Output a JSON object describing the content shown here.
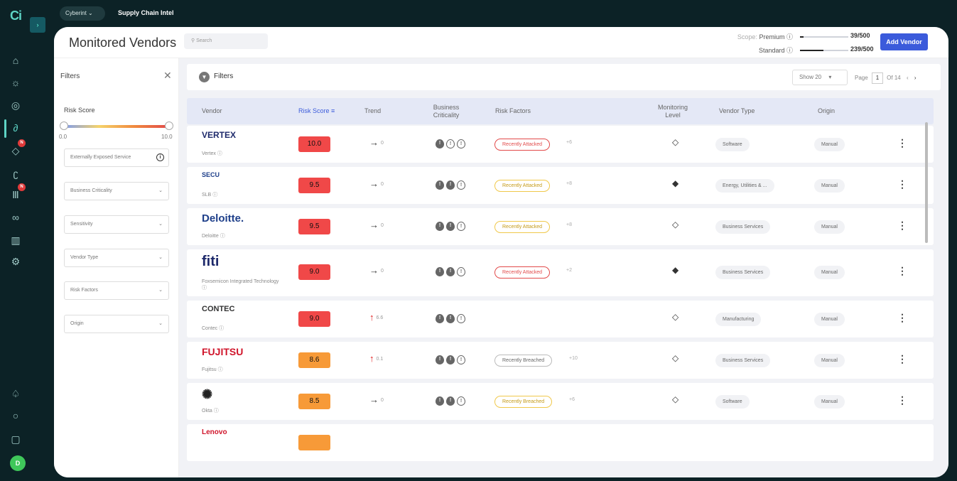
{
  "app": {
    "logo_text": "Ci",
    "expand_icon": "chevron-right-icon",
    "org_label": "Cyberint",
    "product_label": "Supply Chain Intel",
    "avatar_initial": "D",
    "notif_label": "N"
  },
  "rail_icons": [
    "home-icon",
    "alert-bulb-icon",
    "target-icon",
    "link-icon",
    "shield-icon",
    "fingerprint-icon",
    "library-icon",
    "modules-icon",
    "building-icon",
    "settings-icon",
    "notification-icon",
    "search-icon",
    "info-icon"
  ],
  "page": {
    "title": "Monitored Vendors",
    "search_placeholder": "Search"
  },
  "scope": {
    "label": "Scope:",
    "premium_label": "Premium",
    "premium_count": "39/500",
    "premium_fill": 0.078,
    "standard_label": "Standard",
    "standard_count": "239/500",
    "standard_fill": 0.478
  },
  "add_vendor_label": "Add Vendor",
  "filters_panel": {
    "title": "Filters",
    "risk_score_label": "Risk Score",
    "slider_min": "0.0",
    "slider_max": "10.0",
    "externally_exposed_label": "Externally Exposed Service",
    "selects": [
      "Business Criticality",
      "Sensitivity",
      "Vendor Type",
      "Risk Factors",
      "Origin"
    ]
  },
  "toolbar": {
    "filters_label": "Filters",
    "show_label": "Show 20",
    "page_label": "Page",
    "page_value": "1",
    "page_of": "Of 14"
  },
  "columns": {
    "vendor": "Vendor",
    "risk_score": "Risk Score",
    "trend": "Trend",
    "business_criticality": "Business Criticality",
    "risk_factors": "Risk Factors",
    "monitoring_level": "Monitoring Level",
    "vendor_type": "Vendor Type",
    "origin": "Origin"
  },
  "rows": [
    {
      "logo": "VERTEX",
      "name": "Vertex",
      "score": "10.0",
      "score_color": "#f04848",
      "trend_dir": "flat",
      "trend_value": "0",
      "criticality": [
        1,
        0,
        0
      ],
      "risk_factor": "Recently Attacked",
      "rf_style": "red",
      "rf_more": "+6",
      "monitoring": "outline",
      "vendor_type": "Software",
      "origin": "Manual"
    },
    {
      "logo": "SECU",
      "name": "SLB",
      "score": "9.5",
      "score_color": "#f04848",
      "trend_dir": "flat",
      "trend_value": "0",
      "criticality": [
        1,
        1,
        0
      ],
      "risk_factor": "Recently Attacked",
      "rf_style": "yellow",
      "rf_more": "+8",
      "monitoring": "filled",
      "vendor_type": "Energy, Utilities & ...",
      "origin": "Manual"
    },
    {
      "logo": "Deloitte.",
      "name": "Deloitte",
      "score": "9.5",
      "score_color": "#f04848",
      "trend_dir": "flat",
      "trend_value": "0",
      "criticality": [
        1,
        1,
        0
      ],
      "risk_factor": "Recently Attacked",
      "rf_style": "yellow",
      "rf_more": "+8",
      "monitoring": "outline",
      "vendor_type": "Business Services",
      "origin": "Manual"
    },
    {
      "logo": "fiti",
      "name": "Foxsemicon Integrated Technology",
      "score": "9.0",
      "score_color": "#f04848",
      "trend_dir": "flat",
      "trend_value": "0",
      "criticality": [
        1,
        1,
        0
      ],
      "risk_factor": "Recently Attacked",
      "rf_style": "red",
      "rf_more": "+2",
      "monitoring": "filled",
      "vendor_type": "Business Services",
      "origin": "Manual"
    },
    {
      "logo": "CONTEC",
      "name": "Contec",
      "score": "9.0",
      "score_color": "#f04848",
      "trend_dir": "up",
      "trend_value": "6.6",
      "criticality": [
        1,
        1,
        0
      ],
      "risk_factor": "",
      "rf_style": "none",
      "rf_more": "",
      "monitoring": "outline",
      "vendor_type": "Manufacturing",
      "origin": "Manual"
    },
    {
      "logo": "FUJITSU",
      "name": "Fujitsu",
      "score": "8.6",
      "score_color": "#f79a38",
      "trend_dir": "up",
      "trend_value": "0.1",
      "criticality": [
        1,
        1,
        0
      ],
      "risk_factor": "Recently Breached",
      "rf_style": "grey",
      "rf_more": "+10",
      "monitoring": "outline",
      "vendor_type": "Business Services",
      "origin": "Manual"
    },
    {
      "logo": "✺",
      "name": "Okta",
      "score": "8.5",
      "score_color": "#f79a38",
      "trend_dir": "flat",
      "trend_value": "0",
      "criticality": [
        1,
        1,
        0
      ],
      "risk_factor": "Recently Breached",
      "rf_style": "yellow",
      "rf_more": "+6",
      "monitoring": "outline",
      "vendor_type": "Software",
      "origin": "Manual"
    },
    {
      "logo": "Lenovo",
      "name": "",
      "score": "",
      "score_color": "#f79a38",
      "trend_dir": "",
      "trend_value": "",
      "criticality": [],
      "risk_factor": "",
      "rf_style": "none",
      "rf_more": "",
      "monitoring": "",
      "vendor_type": "",
      "origin": ""
    }
  ]
}
